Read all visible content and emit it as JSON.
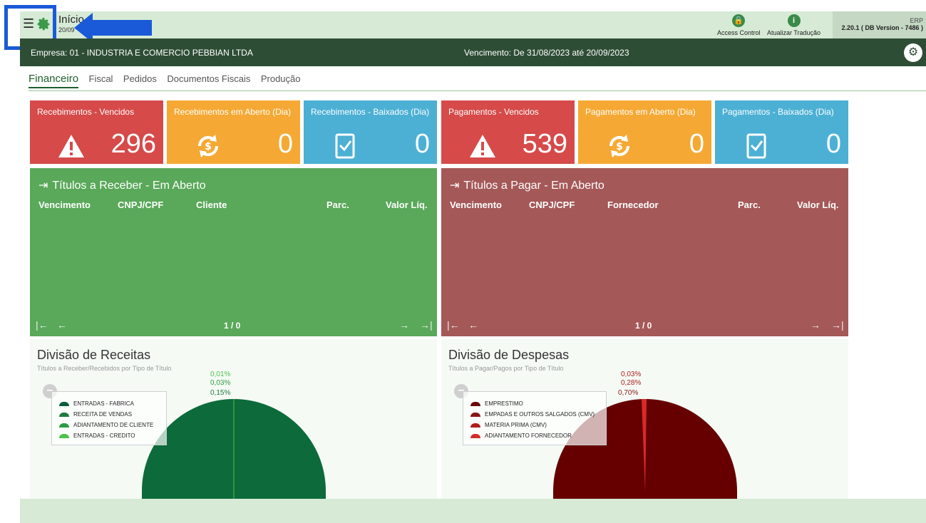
{
  "header": {
    "menu_glyph": "☰",
    "title": "Início",
    "date": "20/09",
    "access_control": "Access Control",
    "atualizar_traducao": "Atualizar Tradução",
    "erp_label": "ERP",
    "version": "2.20.1 ( DB Version - 7486 )"
  },
  "darkbar": {
    "company": "Empresa: 01 - INDUSTRIA E COMERCIO PEBBIAN LTDA",
    "due": "Vencimento: De 31/08/2023 até 20/09/2023"
  },
  "tabs": [
    "Financeiro",
    "Fiscal",
    "Pedidos",
    "Documentos Fiscais",
    "Produção"
  ],
  "cards": [
    {
      "label": "Recebimentos - Vencidos",
      "value": "296",
      "color": "#d64a4a",
      "icon": "warning-icon"
    },
    {
      "label": "Recebimentos em Aberto (Dia)",
      "value": "0",
      "color": "#f5a934",
      "icon": "money-refresh-icon"
    },
    {
      "label": "Recebimentos - Baixados (Dia)",
      "value": "0",
      "color": "#4cb0d4",
      "icon": "checked-document-icon"
    },
    {
      "label": "Pagamentos - Vencidos",
      "value": "539",
      "color": "#d64a4a",
      "icon": "warning-icon"
    },
    {
      "label": "Pagamentos em Aberto (Dia)",
      "value": "0",
      "color": "#f5a934",
      "icon": "money-refresh-icon"
    },
    {
      "label": "Pagamentos - Baixados (Dia)",
      "value": "0",
      "color": "#4cb0d4",
      "icon": "checked-document-icon"
    }
  ],
  "panels": {
    "receber": {
      "title": "Títulos a Receber - Em Aberto",
      "columns": [
        "Vencimento",
        "CNPJ/CPF",
        "Cliente",
        "Parc.",
        "Valor Líq."
      ],
      "pagination": "1 / 0"
    },
    "pagar": {
      "title": "Títulos a Pagar - Em Aberto",
      "columns": [
        "Vencimento",
        "CNPJ/CPF",
        "Fornecedor",
        "Parc.",
        "Valor Líq."
      ],
      "pagination": "1 / 0"
    }
  },
  "pager_glyphs": {
    "first": "|←",
    "prev": "←",
    "next": "→",
    "last": "→|"
  },
  "charts": {
    "receitas": {
      "title": "Divisão de Receitas",
      "subtitle": "Títulos a Receber/Recebidos por Tipo de Título",
      "labels": [
        "0,01%",
        "0,03%",
        "0,15%"
      ],
      "legend": [
        "ENTRADAS - FABRICA",
        "RECEITA DE VENDAS",
        "ADIANTAMENTO DE CLIENTE",
        "ENTRADAS - CREDITO"
      ],
      "colors": [
        "#0d5c3a",
        "#1f7a3f",
        "#2e9a42",
        "#4cc24c"
      ]
    },
    "despesas": {
      "title": "Divisão de Despesas",
      "subtitle": "Títulos a Pagar/Pagos por Tipo de Título",
      "labels": [
        "0,03%",
        "0,28%",
        "0,70%"
      ],
      "legend": [
        "EMPRESTIMO",
        "EMPADAS E OUTROS SALGADOS (CMV)",
        "MATERIA PRIMA (CMV)",
        "ADIANTAMENTO FORNECEDOR"
      ],
      "colors": [
        "#6a0a0a",
        "#8c1616",
        "#b01e1e",
        "#d82a2a"
      ]
    }
  }
}
